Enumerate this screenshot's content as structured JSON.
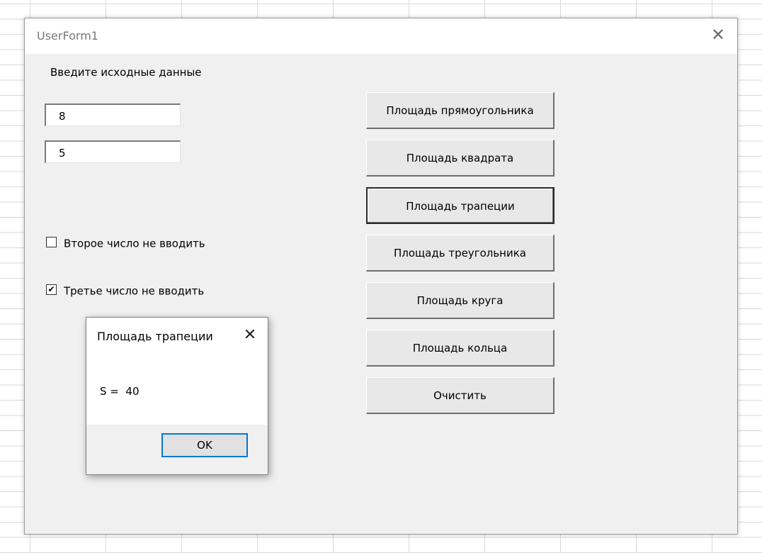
{
  "window": {
    "title": "UserForm1",
    "close_glyph": "✕"
  },
  "form": {
    "prompt_label": "Введите исходные данные",
    "input1_value": "8",
    "input2_value": "5",
    "checkbox1": {
      "label": "Второе число не вводить",
      "checked": false
    },
    "checkbox2": {
      "label": "Третье число не вводить",
      "checked": true,
      "mark": "✔"
    }
  },
  "buttons": [
    {
      "label": "Площадь прямоугольника"
    },
    {
      "label": "Площадь квадрата"
    },
    {
      "label": "Площадь трапеции",
      "focused": true
    },
    {
      "label": "Площадь треугольника"
    },
    {
      "label": "Площадь круга"
    },
    {
      "label": "Площадь кольца"
    },
    {
      "label": "Очистить"
    }
  ],
  "msgbox": {
    "title": "Площадь трапеции",
    "close_glyph": "✕",
    "message": "S =  40",
    "ok_label": "OK"
  },
  "icons": [
    "close-icon",
    "checkbox-check-icon"
  ]
}
